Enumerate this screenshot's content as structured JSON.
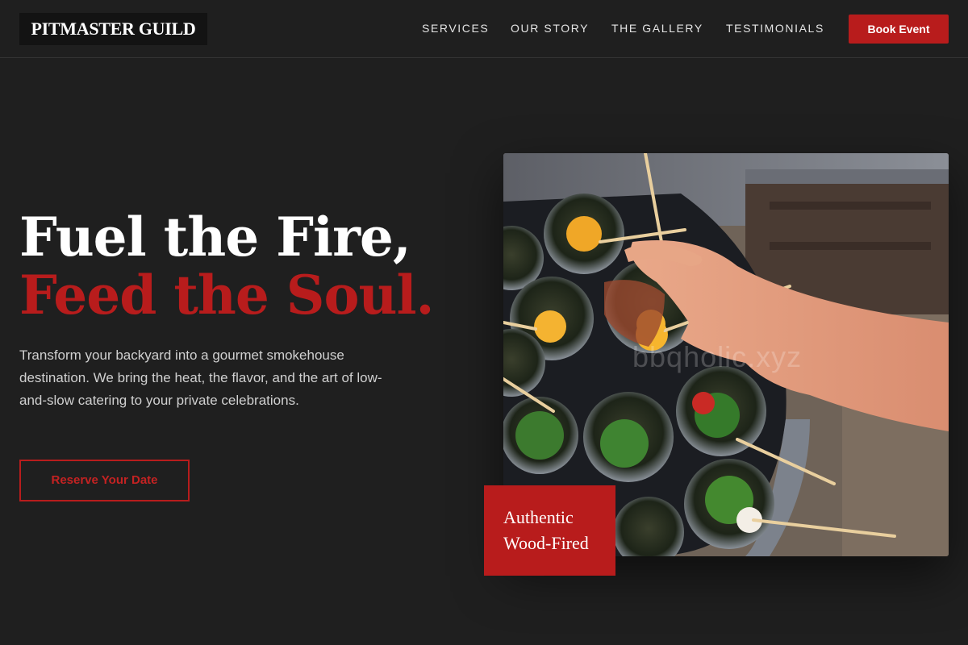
{
  "header": {
    "logo": "PITMASTER GUILD",
    "nav": [
      {
        "label": "SERVICES"
      },
      {
        "label": "OUR STORY"
      },
      {
        "label": "THE GALLERY"
      },
      {
        "label": "TESTIMONIALS"
      }
    ],
    "cta_label": "Book Event"
  },
  "hero": {
    "title_line1": "Fuel the Fire,",
    "title_line2": "Feed the Soul.",
    "description": "Transform your backyard into a gourmet smokehouse destination. We bring the heat, the flavor, and the art of low-and-slow catering to your private celebrations.",
    "cta_label": "Reserve Your Date"
  },
  "image": {
    "watermark": "bbqholic.xyz",
    "badge_line1": "Authentic",
    "badge_line2": "Wood-Fired"
  },
  "colors": {
    "background": "#1f1f1f",
    "accent": "#b81c1c",
    "text": "#ffffff"
  }
}
